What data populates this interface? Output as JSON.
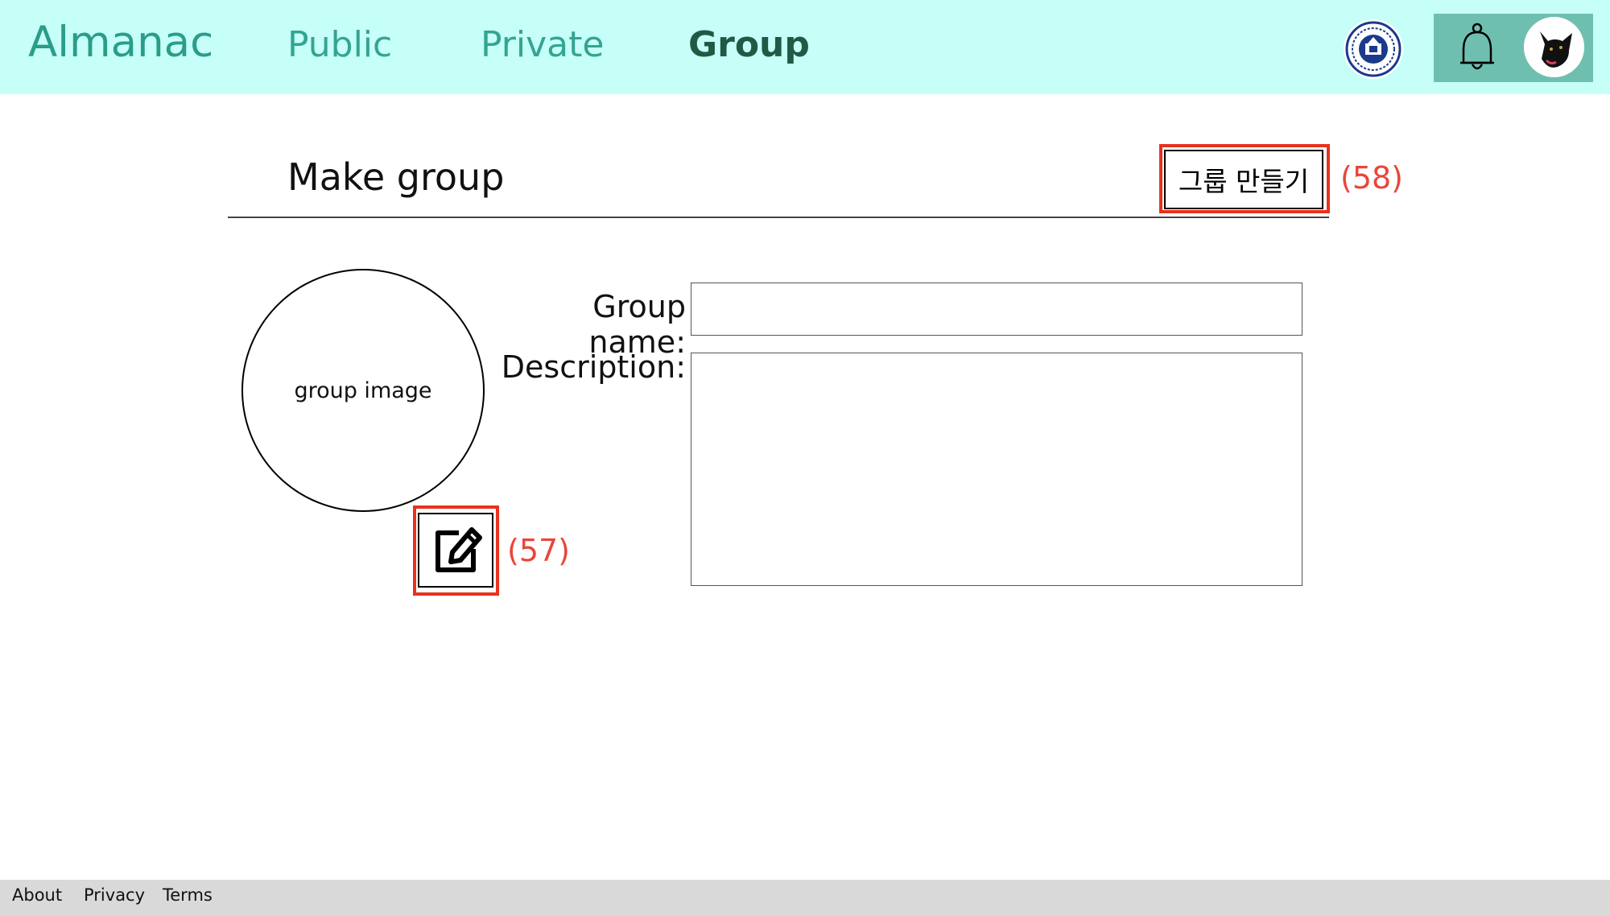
{
  "header": {
    "brand": "Almanac",
    "nav": [
      {
        "label": "Public"
      },
      {
        "label": "Private"
      },
      {
        "label": "Group"
      }
    ],
    "icons": {
      "university_logo": "university-seal-icon",
      "notifications": "bell-icon",
      "avatar": "black-dog-avatar"
    },
    "colors": {
      "header_bg": "#c6fff8",
      "brand": "#2a9d8a",
      "nav": "#35a492",
      "nav_active": "#1f5a44",
      "panel_bg": "#6fbfb1"
    }
  },
  "make_group": {
    "title": "Make group",
    "create_button_label": "그룹 만들기",
    "create_button_annotation": "(58)",
    "image_placeholder": "group image",
    "edit_image_annotation": "(57)",
    "group_name_label": "Group name:",
    "group_name_value": "",
    "description_label": "Description:",
    "description_value": "",
    "annotation_color": "#e8311e"
  },
  "footer": {
    "links": [
      {
        "label": "About"
      },
      {
        "label": "Privacy"
      },
      {
        "label": "Terms"
      }
    ]
  }
}
